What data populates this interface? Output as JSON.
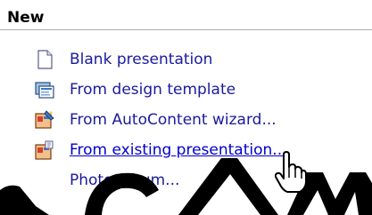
{
  "section": {
    "title": "New"
  },
  "items": [
    {
      "label": "Blank presentation",
      "icon": "blank-page-icon"
    },
    {
      "label": "From design template",
      "icon": "design-template-icon"
    },
    {
      "label": "From AutoContent wizard...",
      "icon": "autocontent-wizard-icon"
    },
    {
      "label": "From existing presentation...",
      "icon": "existing-presentation-icon",
      "hovered": true
    },
    {
      "label": "Photo album...",
      "icon": "photo-album-icon"
    }
  ],
  "colors": {
    "link": "#1a1a9e",
    "link_hover": "#0000cc",
    "header_rule": "#b0b0b0",
    "watermark": "#000000"
  },
  "cursor": "hand-pointer-icon"
}
